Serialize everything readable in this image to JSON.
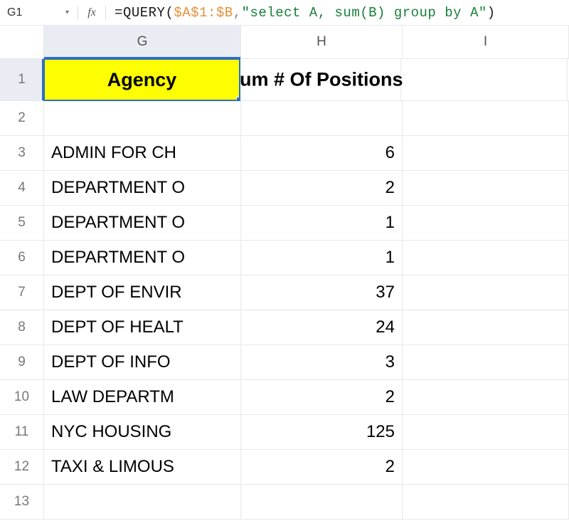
{
  "nameBox": "G1",
  "formula": {
    "eq": "=",
    "func": "QUERY",
    "lp": "(",
    "ref": "$A$1:$B",
    "comma": ",",
    "str": "\"select A, sum(B) group by A\"",
    "rp": ")"
  },
  "fxLabel": "fx",
  "nameArrow": "▾",
  "columns": {
    "g": "G",
    "h": "H",
    "i": "I"
  },
  "rows": {
    "r1": "1",
    "r2": "2",
    "r3": "3",
    "r4": "4",
    "r5": "5",
    "r6": "6",
    "r7": "7",
    "r8": "8",
    "r9": "9",
    "r10": "10",
    "r11": "11",
    "r12": "12",
    "r13": "13"
  },
  "header": {
    "agency": "Agency",
    "sumPositionsFragment": "um # Of Positions"
  },
  "body": {
    "r3": {
      "g": "ADMIN FOR CH",
      "h": "6"
    },
    "r4": {
      "g": "DEPARTMENT O",
      "h": "2"
    },
    "r5": {
      "g": "DEPARTMENT O",
      "h": "1"
    },
    "r6": {
      "g": "DEPARTMENT O",
      "h": "1"
    },
    "r7": {
      "g": "DEPT OF ENVIR",
      "h": "37"
    },
    "r8": {
      "g": "DEPT OF HEALT",
      "h": "24"
    },
    "r9": {
      "g": "DEPT OF INFO",
      "h": "3"
    },
    "r10": {
      "g": "LAW DEPARTM",
      "h": "2"
    },
    "r11": {
      "g": "NYC HOUSING",
      "h": "125"
    },
    "r12": {
      "g": "TAXI & LIMOUS",
      "h": "2"
    }
  }
}
